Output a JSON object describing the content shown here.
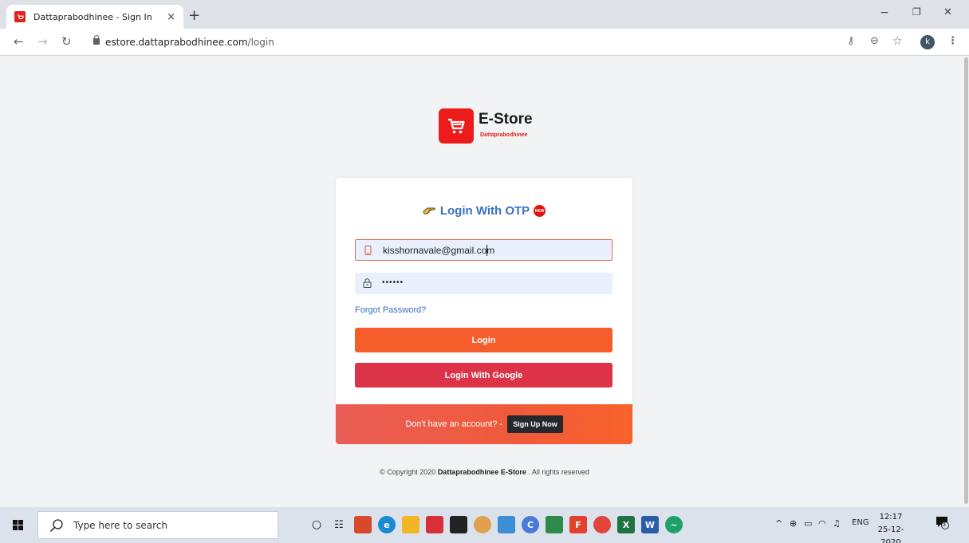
{
  "browser": {
    "tab_title": "Dattaprabodhinee - Sign In",
    "tab_close": "×",
    "new_tab": "+",
    "url_host": "estore.dattaprabodhinee.com",
    "url_path": "/login",
    "profile_initial": "k",
    "minimize": "−",
    "restore": "❐",
    "close": "✕"
  },
  "logo": {
    "title": "E-Store",
    "subtitle": "Dattaprabodhinee"
  },
  "login": {
    "otp_label": "Login With OTP",
    "new_badge": "NEW",
    "email_value": "kisshornavale@gmail.com",
    "password_value": "••••••",
    "forgot_label": "Forgot Password?",
    "login_label": "Login",
    "google_label": "Login With Google"
  },
  "footer": {
    "no_account_text": "Don't have an account? -",
    "signup_label": "Sign Up Now"
  },
  "copyright": {
    "prefix": "© Copyright 2020",
    "brand": "Dattaprabodhinee E-Store",
    "suffix": ". All rights reserved"
  },
  "taskbar": {
    "search_placeholder": "Type here to search",
    "language": "ENG",
    "time": "12:17",
    "date": "25-12-2020",
    "notification_count": "3"
  },
  "colors": {
    "brand_red": "#ee1b1b",
    "login_orange": "#f65c29",
    "google_red": "#dd3349",
    "link_blue": "#3a6fb8"
  }
}
